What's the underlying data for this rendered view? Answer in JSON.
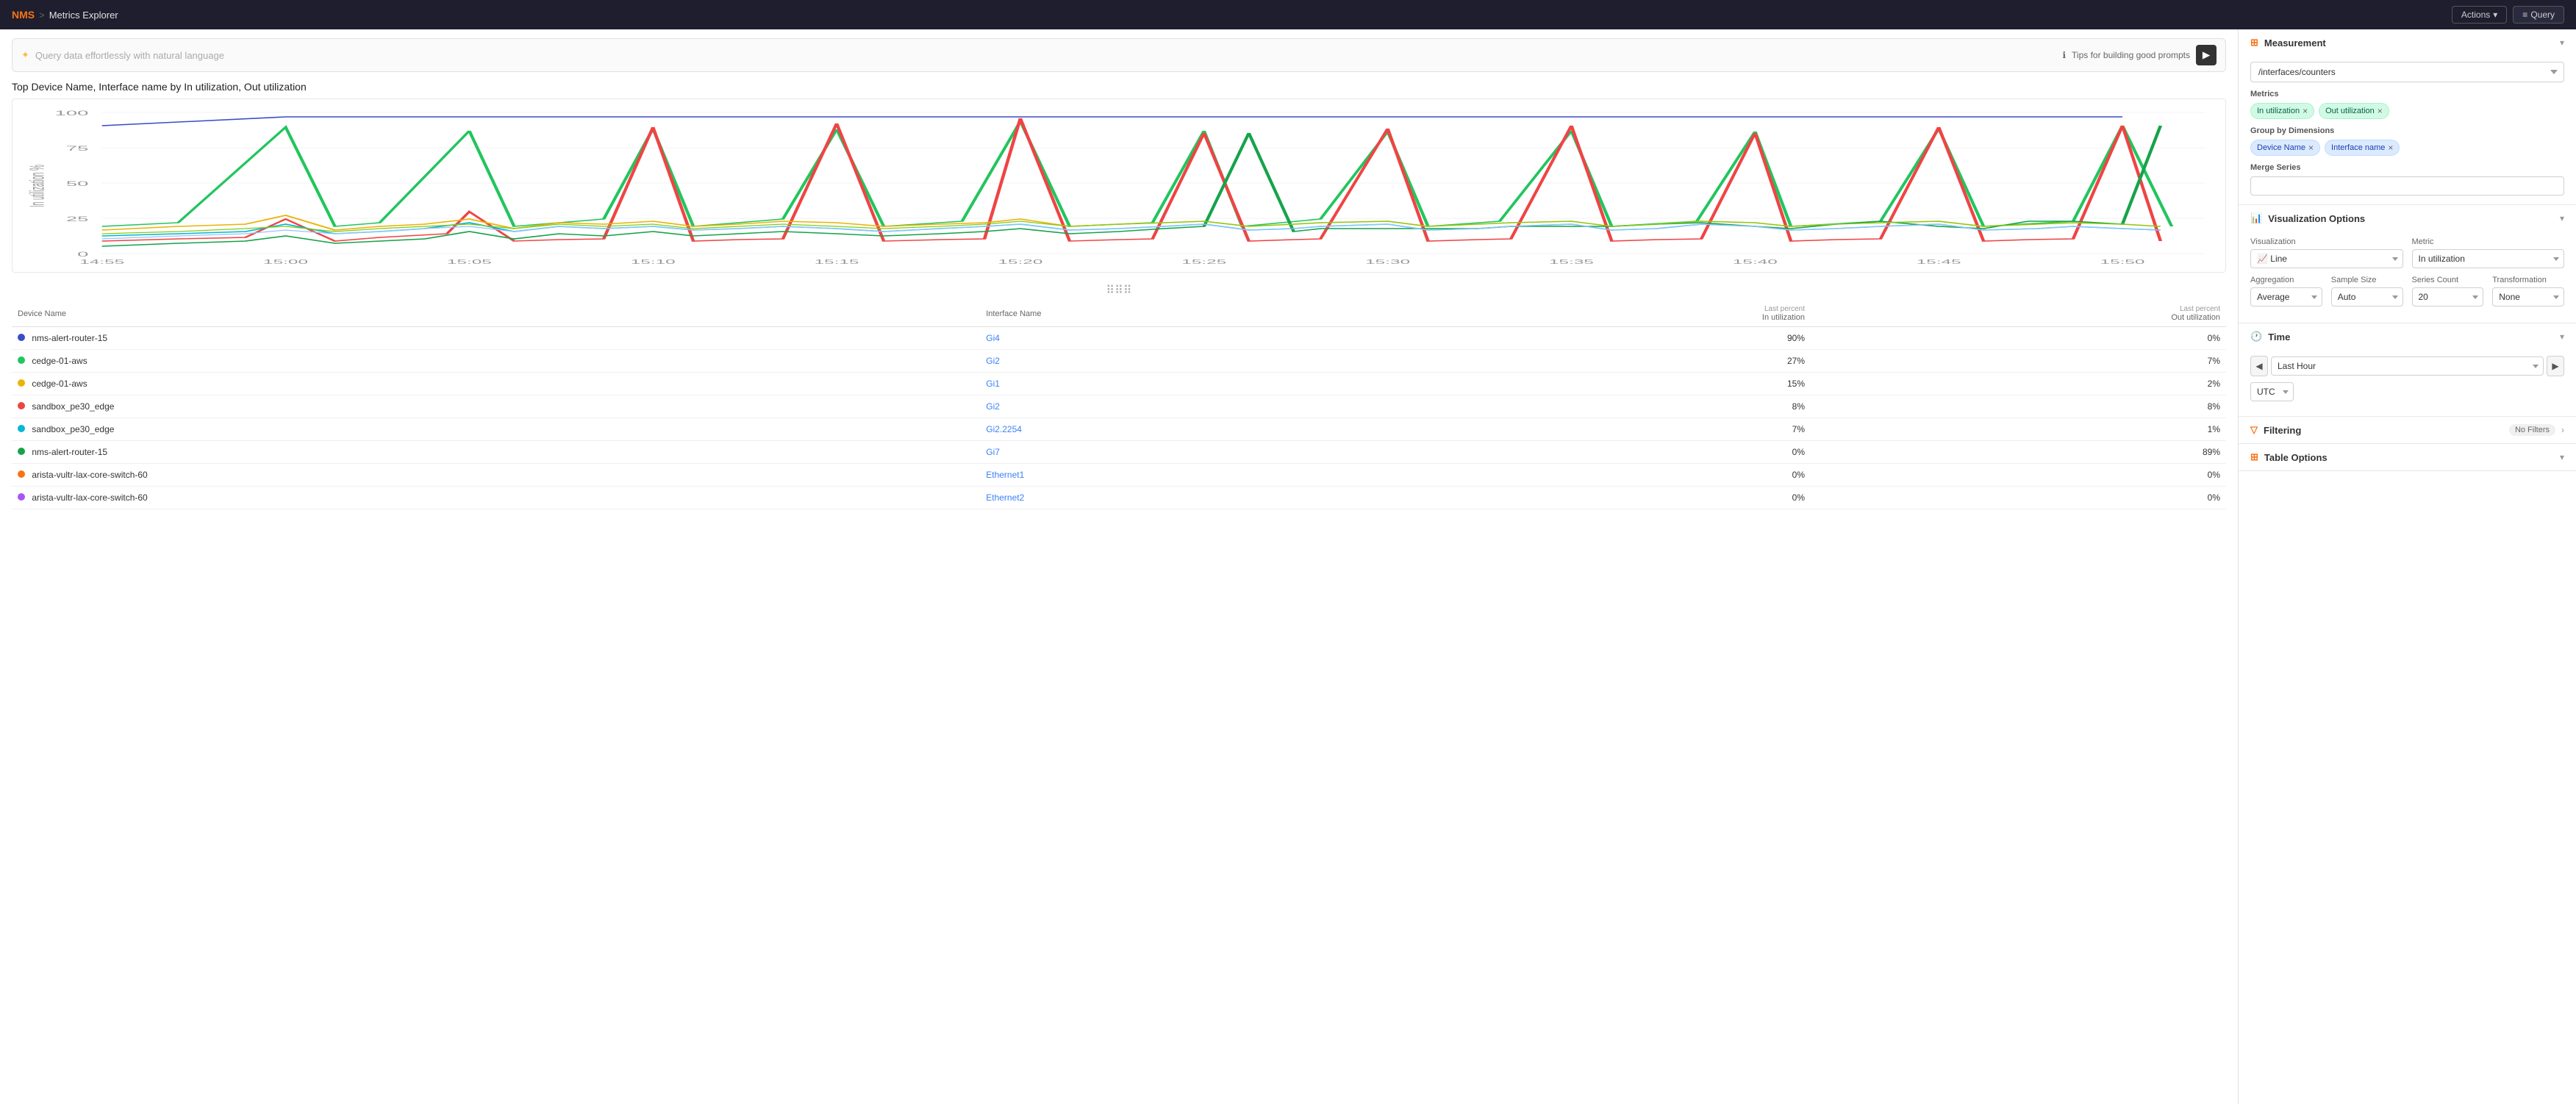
{
  "topnav": {
    "logo": "NMS",
    "separator": ">",
    "page": "Metrics Explorer",
    "actions_label": "Actions",
    "query_label": "Query"
  },
  "querybar": {
    "placeholder": "Query data effortlessly with natural language",
    "tips_label": "Tips for building good prompts",
    "run_icon": "▶"
  },
  "chart": {
    "title": "Top Device Name, Interface name by In utilization, Out utilization",
    "y_axis_label": "In utilization %",
    "y_ticks": [
      "100",
      "75",
      "50",
      "25",
      "0"
    ],
    "x_ticks": [
      "14:55",
      "15:00",
      "15:05",
      "15:10",
      "15:15",
      "15:20",
      "15:25",
      "15:30",
      "15:35",
      "15:40",
      "15:45",
      "15:50"
    ]
  },
  "table": {
    "col_device": "Device Name",
    "col_interface": "Interface Name",
    "col_in_util": "In utilization",
    "col_out_util": "Out utilization",
    "col_in_label": "Last percent",
    "col_out_label": "Last percent",
    "rows": [
      {
        "color": "#3b4bc8",
        "device": "nms-alert-router-15",
        "interface": "Gi4",
        "in_util": "90%",
        "out_util": "0%"
      },
      {
        "color": "#22c55e",
        "device": "cedge-01-aws",
        "interface": "Gi2",
        "in_util": "27%",
        "out_util": "7%"
      },
      {
        "color": "#eab308",
        "device": "cedge-01-aws",
        "interface": "Gi1",
        "in_util": "15%",
        "out_util": "2%"
      },
      {
        "color": "#ef4444",
        "device": "sandbox_pe30_edge",
        "interface": "Gi2",
        "in_util": "8%",
        "out_util": "8%"
      },
      {
        "color": "#06b6d4",
        "device": "sandbox_pe30_edge",
        "interface": "Gi2.2254",
        "in_util": "7%",
        "out_util": "1%"
      },
      {
        "color": "#16a34a",
        "device": "nms-alert-router-15",
        "interface": "Gi7",
        "in_util": "0%",
        "out_util": "89%"
      },
      {
        "color": "#f97316",
        "device": "arista-vultr-lax-core-switch-60",
        "interface": "Ethernet1",
        "in_util": "0%",
        "out_util": "0%"
      },
      {
        "color": "#a855f7",
        "device": "arista-vultr-lax-core-switch-60",
        "interface": "Ethernet2",
        "in_util": "0%",
        "out_util": "0%"
      }
    ]
  },
  "rightpanel": {
    "measurement_title": "Measurement",
    "measurement_value": "/interfaces/counters",
    "metrics_label": "Metrics",
    "metrics": [
      {
        "label": "In utilization",
        "type": "green"
      },
      {
        "label": "Out utilization",
        "type": "green"
      }
    ],
    "groupby_label": "Group by Dimensions",
    "groupby": [
      {
        "label": "Device Name",
        "type": "blue"
      },
      {
        "label": "Interface name",
        "type": "blue"
      }
    ],
    "merge_label": "Merge Series",
    "merge_placeholder": "",
    "viz_title": "Visualization Options",
    "viz_label": "Visualization",
    "viz_value": "Line",
    "metric_label": "Metric",
    "metric_value": "In utilization",
    "aggregation_label": "Aggregation",
    "aggregation_value": "Average",
    "sample_label": "Sample Size",
    "sample_value": "Auto",
    "series_label": "Series Count",
    "series_value": "20",
    "transform_label": "Transformation",
    "transform_value": "None",
    "time_title": "Time",
    "time_nav_left": "◀",
    "time_value": "Last Hour",
    "time_nav_right": "▶",
    "utc_value": "UTC",
    "filtering_title": "Filtering",
    "filtering_badge": "No Filters",
    "table_options_title": "Table Options",
    "viz_icon": "📊",
    "time_icon": "🕐",
    "filter_icon": "🔻",
    "table_icon": "📋"
  }
}
